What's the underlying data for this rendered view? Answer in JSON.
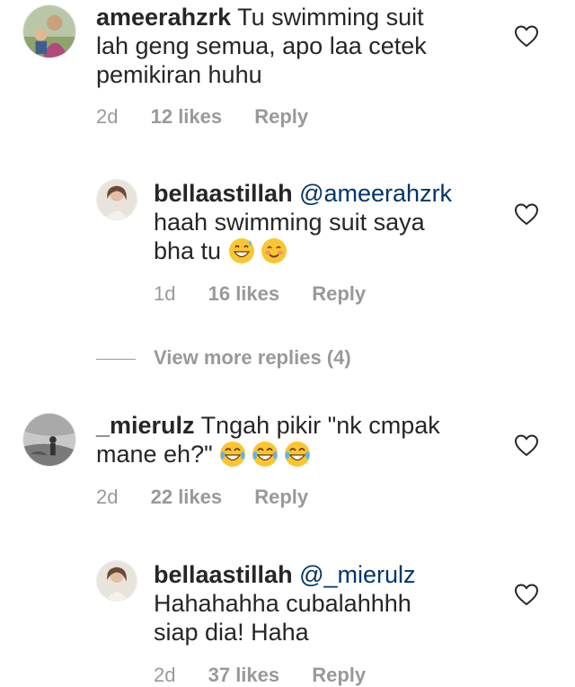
{
  "comments": [
    {
      "username": "ameerahzrk",
      "lines": [
        "Tu swimming suit",
        "lah geng semua, apo laa cetek",
        "pemikiran huhu"
      ],
      "time": "2d",
      "likes": "12 likes",
      "reply": "Reply"
    },
    {
      "username": "bellaastillah",
      "mention": "@ameerahzrk",
      "lines": [
        "haah swimming suit saya",
        "bha tu"
      ],
      "emojis": [
        "grinning-sweat-emoji",
        "smiling-blush-emoji"
      ],
      "time": "1d",
      "likes": "16 likes",
      "reply": "Reply"
    },
    {
      "username": "_mierulz",
      "lines": [
        "Tngah pikir \"nk cmpak",
        "mane eh?\""
      ],
      "emojis": [
        "tears-of-joy-emoji",
        "tears-of-joy-emoji",
        "tears-of-joy-emoji"
      ],
      "time": "2d",
      "likes": "22 likes",
      "reply": "Reply"
    },
    {
      "username": "bellaastillah",
      "mention": "@_mierulz",
      "lines": [
        "Hahahahha cubalahhhh",
        "siap dia! Haha"
      ],
      "time": "2d",
      "likes": "37 likes",
      "reply": "Reply"
    }
  ],
  "view_more_replies": "View more replies (4)",
  "icons": {
    "like": "heart-outline-icon"
  },
  "colors": {
    "text": "#262626",
    "meta": "#999999",
    "mention": "#003569"
  }
}
